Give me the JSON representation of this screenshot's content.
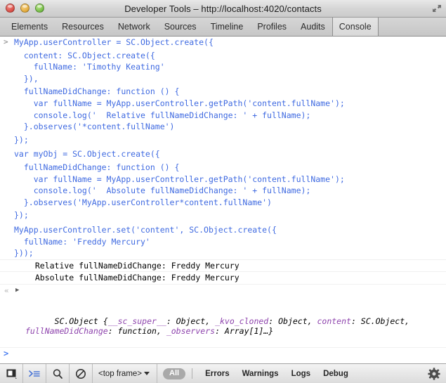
{
  "window": {
    "title": "Developer Tools – http://localhost:4020/contacts",
    "controls": [
      "close",
      "minimize",
      "zoom"
    ],
    "resize_icon": "expand-icon"
  },
  "tabs": [
    {
      "label": "Elements",
      "selected": false
    },
    {
      "label": "Resources",
      "selected": false
    },
    {
      "label": "Network",
      "selected": false
    },
    {
      "label": "Sources",
      "selected": false
    },
    {
      "label": "Timeline",
      "selected": false
    },
    {
      "label": "Profiles",
      "selected": false
    },
    {
      "label": "Audits",
      "selected": false
    },
    {
      "label": "Console",
      "selected": true
    }
  ],
  "console": {
    "input_marker": ">",
    "prompt_marker": ">",
    "entries": [
      {
        "type": "input",
        "marker": ">",
        "text": "MyApp.userController = SC.Object.create({"
      },
      {
        "type": "input",
        "marker": "",
        "text": ""
      },
      {
        "type": "input",
        "marker": "",
        "text": "  content: SC.Object.create({"
      },
      {
        "type": "input",
        "marker": "",
        "text": "    fullName: 'Timothy Keating'"
      },
      {
        "type": "input",
        "marker": "",
        "text": "  }),"
      },
      {
        "type": "input",
        "marker": "",
        "text": ""
      },
      {
        "type": "input",
        "marker": "",
        "text": "  fullNameDidChange: function () {"
      },
      {
        "type": "input",
        "marker": "",
        "text": "    var fullName = MyApp.userController.getPath('content.fullName');"
      },
      {
        "type": "input",
        "marker": "",
        "text": "    console.log('  Relative fullNameDidChange: ' + fullName);"
      },
      {
        "type": "input",
        "marker": "",
        "text": "  }.observes('*content.fullName')"
      },
      {
        "type": "input",
        "marker": "",
        "text": ""
      },
      {
        "type": "input",
        "marker": "",
        "text": "});"
      },
      {
        "type": "input",
        "marker": "",
        "text": ""
      },
      {
        "type": "input",
        "marker": "",
        "text": ""
      },
      {
        "type": "input",
        "marker": "",
        "text": "var myObj = SC.Object.create({"
      },
      {
        "type": "input",
        "marker": "",
        "text": ""
      },
      {
        "type": "input",
        "marker": "",
        "text": "  fullNameDidChange: function () {"
      },
      {
        "type": "input",
        "marker": "",
        "text": "    var fullName = MyApp.userController.getPath('content.fullName');"
      },
      {
        "type": "input",
        "marker": "",
        "text": "    console.log('  Absolute fullNameDidChange: ' + fullName);"
      },
      {
        "type": "input",
        "marker": "",
        "text": "  }.observes('MyApp.userController*content.fullName')"
      },
      {
        "type": "input",
        "marker": "",
        "text": ""
      },
      {
        "type": "input",
        "marker": "",
        "text": "});"
      },
      {
        "type": "input",
        "marker": "",
        "text": ""
      },
      {
        "type": "input",
        "marker": "",
        "text": ""
      },
      {
        "type": "input",
        "marker": "",
        "text": "MyApp.userController.set('content', SC.Object.create({"
      },
      {
        "type": "input",
        "marker": "",
        "text": "  fullName: 'Freddy Mercury'"
      },
      {
        "type": "input",
        "marker": "",
        "text": "}));"
      }
    ],
    "logs": [
      {
        "type": "log",
        "text": "  Relative fullNameDidChange: Freddy Mercury"
      },
      {
        "type": "log",
        "text": "  Absolute fullNameDidChange: Freddy Mercury"
      }
    ],
    "result": {
      "back_marker": "«",
      "disclosure": "▶",
      "line1_prefix": "SC.Object {",
      "props_line1": [
        {
          "name": "__sc_super__",
          "value": "Object"
        },
        {
          "name": "_kvo_cloned",
          "value": "Object"
        },
        {
          "name": "content",
          "value": "SC.Object"
        }
      ],
      "props_line2": [
        {
          "name": "fullNameDidChange",
          "value": "function"
        },
        {
          "name": "_observers",
          "value": "Array[1]"
        }
      ],
      "line2_suffix": "…}"
    }
  },
  "statusbar": {
    "buttons": [
      {
        "name": "dock-panel-icon",
        "title": "Dock to main window"
      },
      {
        "name": "console-drawer-icon",
        "title": "Show console"
      },
      {
        "name": "search-icon",
        "title": "Search"
      },
      {
        "name": "clear-console-icon",
        "title": "Clear console"
      }
    ],
    "frame_selector": {
      "label": "<top frame>",
      "caret": "▾"
    },
    "filters": [
      {
        "label": "All",
        "active": true
      },
      {
        "label": "Errors",
        "active": false
      },
      {
        "label": "Warnings",
        "active": false
      },
      {
        "label": "Logs",
        "active": false
      },
      {
        "label": "Debug",
        "active": false
      }
    ],
    "settings_icon": "gear-icon"
  },
  "colors": {
    "code_blue": "#3f6ae1",
    "property_purple": "#8e44ad",
    "log_black": "#000000",
    "pill_gray": "#a9a9a9"
  }
}
